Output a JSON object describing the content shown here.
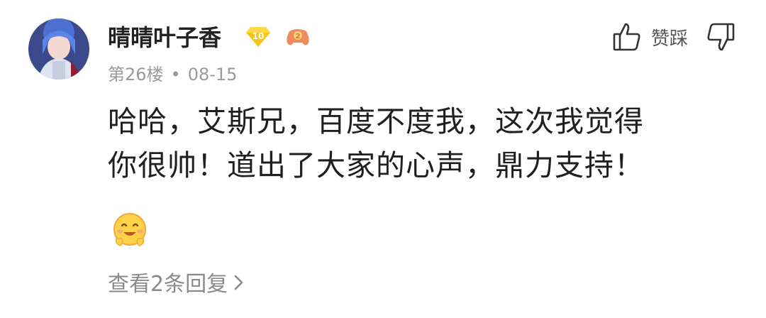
{
  "comment": {
    "username": "晴晴叶子香",
    "level_badge": "10",
    "floor": "第26楼",
    "separator": "•",
    "date": "08-15",
    "vote_label": "赞踩",
    "text_line1": "哈哈，艾斯兄，百度不度我，这次我觉得",
    "text_line2": "你很帅！道出了大家的心声，鼎力支持！",
    "reply_link": "查看2条回复"
  },
  "icons": {
    "avatar": "anime-avatar",
    "level": "diamond-level-icon",
    "game": "gamepad-badge-icon",
    "like": "thumbs-up-icon",
    "dislike": "thumbs-down-icon",
    "emoji": "smiling-emoji-icon",
    "chevron": "chevron-right-icon"
  },
  "colors": {
    "level_badge": "#f5c518",
    "game_badge": "#f08a5d",
    "meta_text": "#9a9a9a",
    "emoji": "#ffd24a"
  }
}
